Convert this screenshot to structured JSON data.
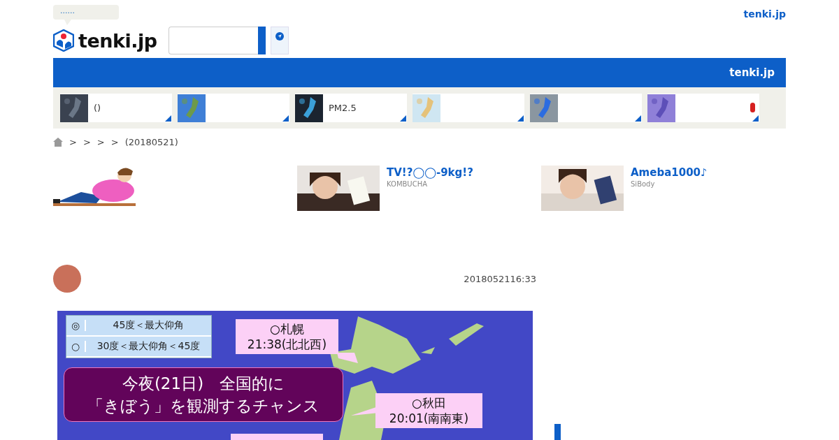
{
  "header": {
    "bubble": "......",
    "logo": "tenki.jp",
    "top_link": "tenki.jp"
  },
  "nav_bar": {
    "title": "tenki.jp"
  },
  "tiles": [
    {
      "kind": "night",
      "label": "()",
      "badge": false
    },
    {
      "kind": "sea",
      "badge": false
    },
    {
      "kind": "dark",
      "label": "PM2.5",
      "badge": false
    },
    {
      "kind": "map",
      "badge": false
    },
    {
      "kind": "radar",
      "badge": false
    },
    {
      "kind": "flower",
      "badge": true
    }
  ],
  "breadcrumb": [
    ">",
    ">",
    ">",
    ">",
    "(20180521)"
  ],
  "ads": [
    {
      "kind": "illustration"
    },
    {
      "title": "TV!?◯◯-9kg!?",
      "source": "KOMBUCHA"
    },
    {
      "title": "Ameba1000♪",
      "source": "SiBody"
    }
  ],
  "article": {
    "date": "2018052116:33",
    "map": {
      "legend": [
        {
          "mark": "◎",
          "text": "45度＜最大仰角"
        },
        {
          "mark": "○",
          "text": "30度＜最大仰角＜45度"
        }
      ],
      "headline": [
        "今夜(21日)　全国的に",
        "「きぼう」を観測するチャンス"
      ],
      "callouts": [
        {
          "city": "○札幌",
          "time": "21:38(北北西)"
        },
        {
          "city": "○秋田",
          "time": "20:01(南南東)"
        }
      ]
    }
  }
}
